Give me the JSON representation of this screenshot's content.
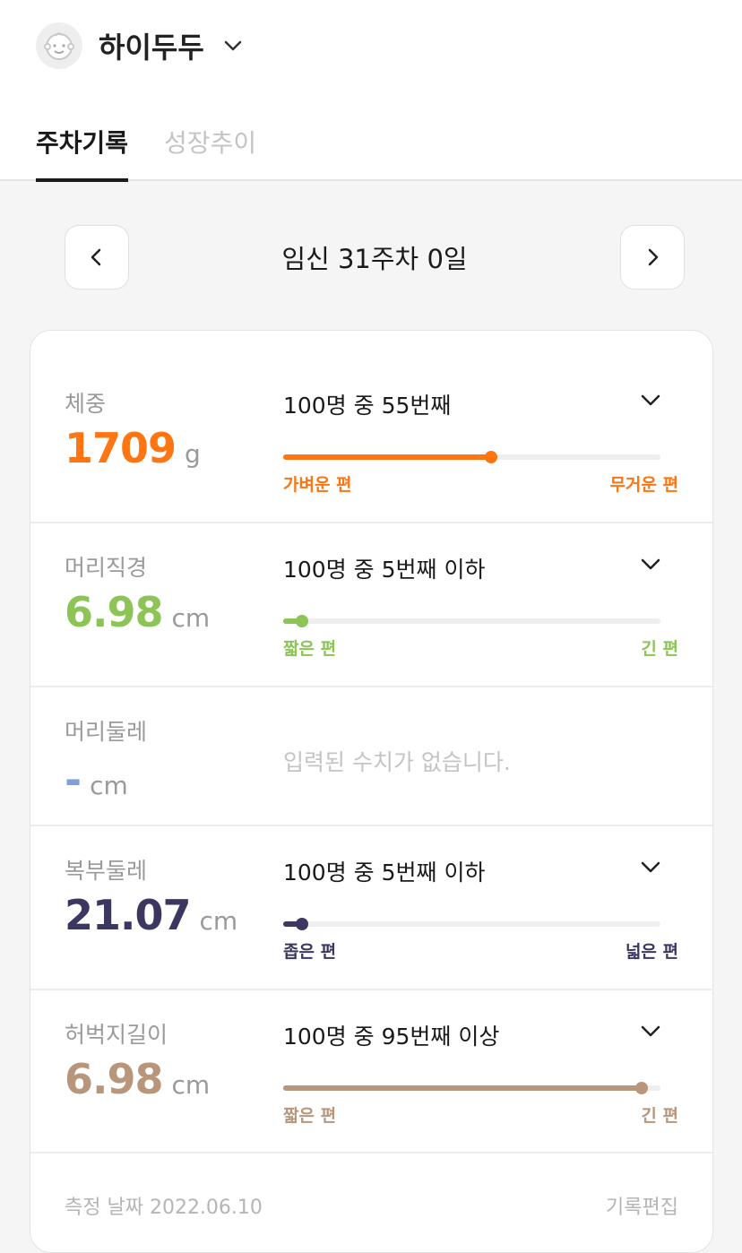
{
  "profile": {
    "name": "하이두두"
  },
  "tabs": [
    {
      "label": "주차기록",
      "active": true
    },
    {
      "label": "성장추이",
      "active": false
    }
  ],
  "week": {
    "label": "임신 31주차 0일"
  },
  "colors": {
    "weight": "#ff7512",
    "bpd": "#8cc456",
    "hc": "#7ea1de",
    "ac": "#3b3760",
    "fl": "#b7967b"
  },
  "metrics": [
    {
      "name": "체중",
      "value": "1709",
      "unit": "g",
      "rank": "100명 중 55번째",
      "percent": 55,
      "left_label": "가벼운 편",
      "right_label": "무거운 편"
    },
    {
      "name": "머리직경",
      "value": "6.98",
      "unit": "cm",
      "rank": "100명 중 5번째 이하",
      "percent": 5,
      "left_label": "짧은 편",
      "right_label": "긴 편"
    },
    {
      "name": "머리둘레",
      "value": "-",
      "unit": "cm",
      "empty_message": "입력된 수치가 없습니다."
    },
    {
      "name": "복부둘레",
      "value": "21.07",
      "unit": "cm",
      "rank": "100명 중 5번째 이하",
      "percent": 5,
      "left_label": "좁은 편",
      "right_label": "넓은 편"
    },
    {
      "name": "허벅지길이",
      "value": "6.98",
      "unit": "cm",
      "rank": "100명 중 95번째 이상",
      "percent": 95,
      "left_label": "짧은 편",
      "right_label": "긴 편"
    }
  ],
  "footer": {
    "measure_date": "측정 날짜 2022.06.10",
    "edit_label": "기록편집"
  }
}
